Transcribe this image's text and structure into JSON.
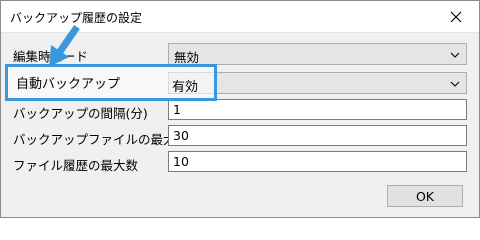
{
  "window": {
    "title": "バックアップ履歴の設定"
  },
  "rows": [
    {
      "label": "編集時モード",
      "value": "無効"
    },
    {
      "label": "自動バックアップ",
      "value": "有効"
    },
    {
      "label": "バックアップの間隔(分)",
      "value": "1"
    },
    {
      "label": "バックアップファイルの最大数",
      "value": "30"
    },
    {
      "label": "ファイル履歴の最大数",
      "value": "10"
    }
  ],
  "buttons": {
    "ok": "OK"
  },
  "icons": {
    "close": "close-icon",
    "dropdown": "chevron-down-icon",
    "annotation": "arrow-annotation"
  },
  "colors": {
    "highlight": "#3a96dd"
  }
}
